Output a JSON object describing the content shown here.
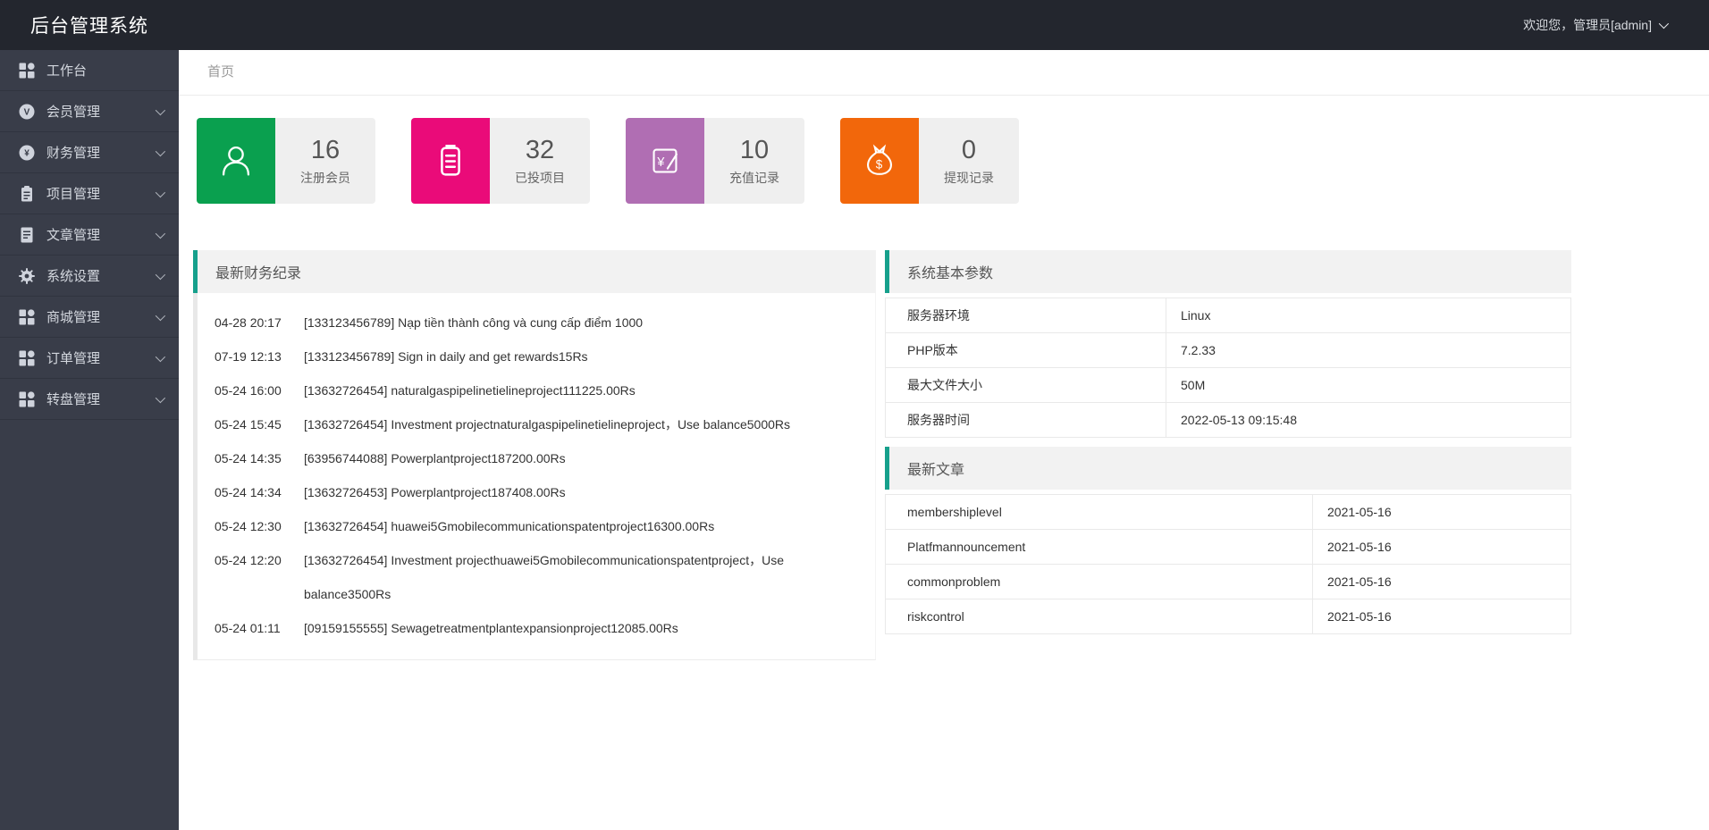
{
  "app": {
    "title": "后台管理系统",
    "welcome": "欢迎您，管理员[admin]"
  },
  "breadcrumb": {
    "home": "首页"
  },
  "sidebar": {
    "items": [
      {
        "label": "工作台",
        "icon": "grid-icon",
        "expandable": false
      },
      {
        "label": "会员管理",
        "icon": "member-icon",
        "expandable": true
      },
      {
        "label": "财务管理",
        "icon": "finance-icon",
        "expandable": true
      },
      {
        "label": "项目管理",
        "icon": "project-icon",
        "expandable": true
      },
      {
        "label": "文章管理",
        "icon": "article-icon",
        "expandable": true
      },
      {
        "label": "系统设置",
        "icon": "settings-icon",
        "expandable": true
      },
      {
        "label": "商城管理",
        "icon": "mall-icon",
        "expandable": true
      },
      {
        "label": "订单管理",
        "icon": "order-icon",
        "expandable": true
      },
      {
        "label": "转盘管理",
        "icon": "wheel-icon",
        "expandable": true
      }
    ]
  },
  "stats": [
    {
      "value": "16",
      "label": "注册会员",
      "color": "#0aa04f",
      "icon": "user-icon"
    },
    {
      "value": "32",
      "label": "已投项目",
      "color": "#ea0b79",
      "icon": "clipboard-icon"
    },
    {
      "value": "10",
      "label": "充值记录",
      "color": "#b06eb3",
      "icon": "recharge-icon"
    },
    {
      "value": "0",
      "label": "提现记录",
      "color": "#f2670b",
      "icon": "moneybag-icon"
    }
  ],
  "finance_panel": {
    "title": "最新财务纪录",
    "records": [
      {
        "time": "04-28 20:17",
        "text": "[133123456789] Nạp tiền thành công và cung cấp điểm 1000"
      },
      {
        "time": "07-19 12:13",
        "text": "[133123456789] Sign in daily and get rewards15Rs"
      },
      {
        "time": "05-24 16:00",
        "text": "[13632726454] naturalgaspipelinetielineproject111225.00Rs"
      },
      {
        "time": "05-24 15:45",
        "text": "[13632726454] Investment projectnaturalgaspipelinetielineproject，Use balance5000Rs"
      },
      {
        "time": "05-24 14:35",
        "text": "[63956744088] Powerplantproject187200.00Rs"
      },
      {
        "time": "05-24 14:34",
        "text": "[13632726453] Powerplantproject187408.00Rs"
      },
      {
        "time": "05-24 12:30",
        "text": "[13632726454] huawei5Gmobilecommunicationspatentproject16300.00Rs"
      },
      {
        "time": "05-24 12:20",
        "text": "[13632726454] Investment projecthuawei5Gmobilecommunicationspatentproject，Use balance3500Rs"
      },
      {
        "time": "05-24 01:11",
        "text": "[09159155555] Sewagetreatmentplantexpansionproject12085.00Rs"
      }
    ]
  },
  "system_panel": {
    "title": "系统基本参数",
    "rows": [
      {
        "label": "服务器环境",
        "value": "Linux"
      },
      {
        "label": "PHP版本",
        "value": "7.2.33"
      },
      {
        "label": "最大文件大小",
        "value": "50M"
      },
      {
        "label": "服务器时间",
        "value": "2022-05-13 09:15:48"
      }
    ]
  },
  "articles_panel": {
    "title": "最新文章",
    "rows": [
      {
        "title": "membershiplevel",
        "date": "2021-05-16"
      },
      {
        "title": "Platfmannouncement",
        "date": "2021-05-16"
      },
      {
        "title": "commonproblem",
        "date": "2021-05-16"
      },
      {
        "title": "riskcontrol",
        "date": "2021-05-16"
      }
    ]
  },
  "theme": {
    "topbar_bg": "#23262e",
    "sidebar_bg": "#393d49",
    "accent_teal": "#16a08c",
    "panel_header_bg": "#f2f2f2",
    "card_body_bg": "#efefef"
  }
}
